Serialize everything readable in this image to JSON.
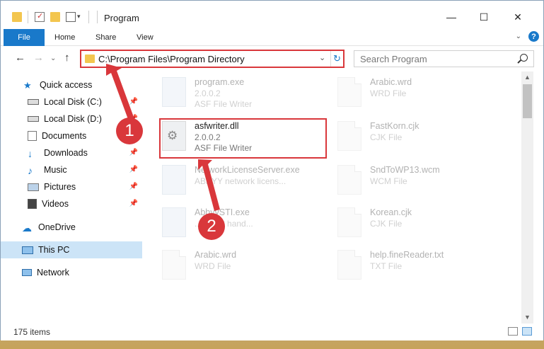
{
  "title": "Program",
  "ribbon": {
    "file": "File",
    "home": "Home",
    "share": "Share",
    "view": "View",
    "help": "?"
  },
  "window_controls": {
    "minimize": "—",
    "maximize": "☐",
    "close": "✕"
  },
  "address": {
    "path": "C:\\Program Files\\Program Directory"
  },
  "search": {
    "placeholder": "Search Program"
  },
  "sidebar": {
    "items": [
      {
        "label": "Quick access",
        "icon": "star-icon"
      },
      {
        "label": "Local Disk (C:)",
        "icon": "drive-icon",
        "pinned": true
      },
      {
        "label": "Local Disk (D:)",
        "icon": "drive-icon",
        "pinned": true
      },
      {
        "label": "Documents",
        "icon": "documents-icon",
        "pinned": true
      },
      {
        "label": "Downloads",
        "icon": "download-icon",
        "pinned": true
      },
      {
        "label": "Music",
        "icon": "music-icon",
        "pinned": true
      },
      {
        "label": "Pictures",
        "icon": "pictures-icon",
        "pinned": true
      },
      {
        "label": "Videos",
        "icon": "videos-icon",
        "pinned": true
      },
      {
        "label": "OneDrive",
        "icon": "cloud-icon"
      },
      {
        "label": "This PC",
        "icon": "computer-icon",
        "selected": true
      },
      {
        "label": "Network",
        "icon": "network-icon"
      }
    ]
  },
  "files": {
    "f0": {
      "name": "program.exe",
      "line2": "2.0.0.2",
      "line3": "ASF File Writer"
    },
    "f1": {
      "name": "Arabic.wrd",
      "line2": "WRD File"
    },
    "f2": {
      "name": "asfwriter.dll",
      "line2": "2.0.0.2",
      "line3": "ASF File Writer"
    },
    "f3": {
      "name": "FastKorn.cjk",
      "line2": "CJK File"
    },
    "f4": {
      "name": "NetworkLicenseServer.exe",
      "line2": "ABBYY network licens..."
    },
    "f5": {
      "name": "SndToWP13.wcm",
      "line2": "WCM File"
    },
    "f6": {
      "name": "AbbyySTI.exe",
      "line2": "... event hand..."
    },
    "f7": {
      "name": "Korean.cjk",
      "line2": "CJK File"
    },
    "f8": {
      "name": "Arabic.wrd",
      "line2": "WRD File"
    },
    "f9": {
      "name": "help.fineReader.txt",
      "line2": "TXT File"
    }
  },
  "status": {
    "count": "175 items"
  },
  "annotations": {
    "step1": "1",
    "step2": "2"
  },
  "colors": {
    "accent": "#1979ca",
    "highlight": "#d9373b",
    "selected": "#cce4f7"
  }
}
